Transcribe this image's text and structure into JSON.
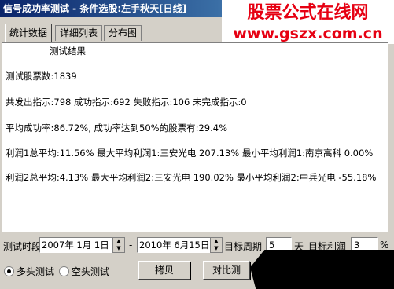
{
  "window": {
    "title": "信号成功率测试 - 条件选股:左手秋天[日线]"
  },
  "watermark": {
    "line1": "股票公式在线网",
    "line2": "www.gszx.com.cn"
  },
  "tabs": [
    {
      "label": "统计数据",
      "active": true
    },
    {
      "label": "详细列表",
      "active": false
    },
    {
      "label": "分布图",
      "active": false
    }
  ],
  "results": {
    "title": "测试结果",
    "lines": [
      "测试股票数:1839",
      "共发出指示:798 成功指示:692 失败指示:106 未完成指示:0",
      "平均成功率:86.72%, 成功率达到50%的股票有:29.4%",
      "利润1总平均:11.56% 最大平均利润1:三安光电 207.13% 最小平均利润1:南京高科 0.00%",
      "利润2总平均:4.13% 最大平均利润2:三安光电 190.02% 最小平均利润2:中兵光电 -55.18%"
    ]
  },
  "controls": {
    "period_label": "测试时段",
    "start_date": "2007年 1月 1日",
    "dash": "-",
    "end_date": "2010年 6月15日",
    "target_period_label": "目标周期",
    "target_period_value": "5",
    "days_label": "天",
    "target_profit_label": "目标利润",
    "target_profit_value": "3",
    "percent_sign": "%",
    "long_test_label": "多头测试",
    "short_test_label": "空头测试",
    "copy_button": "拷贝",
    "compare_button": "对比测"
  }
}
